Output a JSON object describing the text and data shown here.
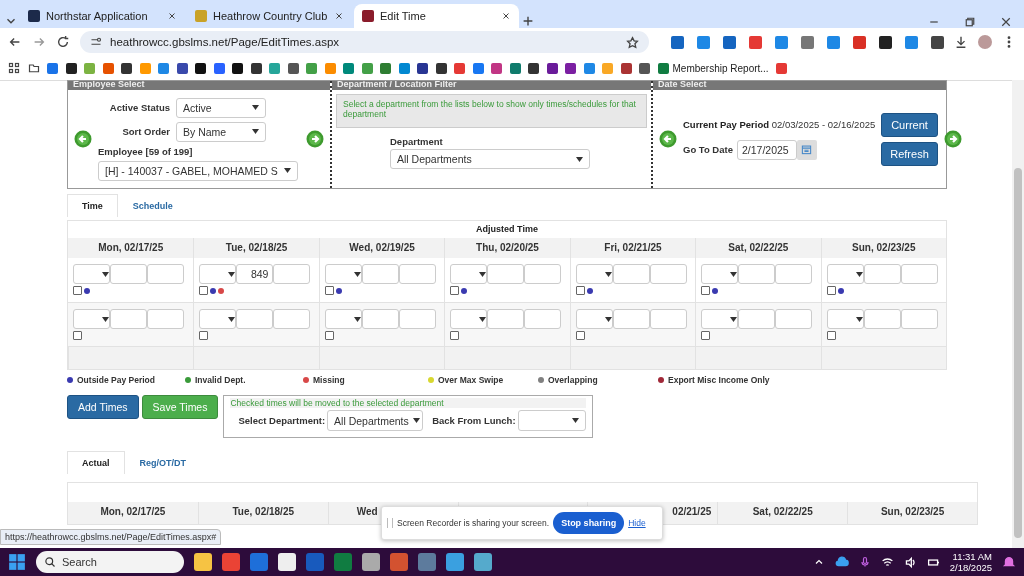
{
  "browser": {
    "tabs": [
      {
        "title": "Northstar Application",
        "selected": false
      },
      {
        "title": "Heathrow Country Club",
        "selected": false
      },
      {
        "title": "Edit Time",
        "selected": true
      }
    ],
    "url": "heathrowcc.gbslms.net/Page/EditTimes.aspx",
    "bookmark": "Membership Report..."
  },
  "employee_select": {
    "title": "Employee Select",
    "active_status_label": "Active Status",
    "active_status": "Active",
    "sort_order_label": "Sort Order",
    "sort_order": "By Name",
    "employee_label": "Employee [59 of 199]",
    "employee": "[H] - 140037 - GABEL, MOHAMED S"
  },
  "department_filter": {
    "title": "Department / Location Filter",
    "note": "Select a department from the lists below to show only times/schedules for that department",
    "label": "Department",
    "value": "All Departments"
  },
  "date_select": {
    "title": "Date Select",
    "pay_period_label": "Current Pay Period",
    "pay_period": "02/03/2025 - 02/16/2025",
    "go_to_label": "Go To Date",
    "go_to_value": "2/17/2025",
    "buttons": [
      "Current",
      "Refresh"
    ]
  },
  "time_tabs": [
    {
      "label": "Time",
      "selected": true
    },
    {
      "label": "Schedule",
      "selected": false
    }
  ],
  "adjusted_time": {
    "title": "Adjusted Time",
    "days": [
      {
        "label": "Mon, 02/17/25",
        "entries": [
          {
            "checked": false,
            "dots": [
              {
                "color": "#3a3ab0"
              }
            ]
          },
          {
            "checked": false
          }
        ]
      },
      {
        "label": "Tue, 02/18/25",
        "entries": [
          {
            "value": "849",
            "checked": false,
            "dots": [
              {
                "color": "#3a3ab0"
              },
              {
                "color": "#d84848"
              }
            ]
          },
          {
            "checked": false
          }
        ]
      },
      {
        "label": "Wed, 02/19/25",
        "entries": [
          {
            "checked": false,
            "dots": [
              {
                "color": "#3a3ab0"
              }
            ]
          },
          {
            "checked": false
          }
        ]
      },
      {
        "label": "Thu, 02/20/25",
        "entries": [
          {
            "checked": false,
            "dots": [
              {
                "color": "#3a3ab0"
              }
            ]
          },
          {
            "checked": false
          }
        ]
      },
      {
        "label": "Fri, 02/21/25",
        "entries": [
          {
            "checked": false,
            "dots": [
              {
                "color": "#3a3ab0"
              }
            ]
          },
          {
            "checked": false
          }
        ]
      },
      {
        "label": "Sat, 02/22/25",
        "entries": [
          {
            "checked": false,
            "dots": [
              {
                "color": "#3a3ab0"
              }
            ]
          },
          {
            "checked": false
          }
        ]
      },
      {
        "label": "Sun, 02/23/25",
        "entries": [
          {
            "checked": false,
            "dots": [
              {
                "color": "#3a3ab0"
              }
            ]
          },
          {
            "checked": false
          }
        ]
      }
    ]
  },
  "legend": [
    {
      "label": "Outside Pay Period",
      "color": "#3a3ab0"
    },
    {
      "label": "Invalid Dept.",
      "color": "#3a9a3a"
    },
    {
      "label": "Missing",
      "color": "#d84848"
    },
    {
      "label": "Over Max Swipe",
      "color": "#d8d830"
    },
    {
      "label": "Overlapping",
      "color": "#808080"
    },
    {
      "label": "Export Misc Income Only",
      "color": "#a02838"
    }
  ],
  "actions": {
    "buttons": [
      {
        "label": "Add Times",
        "kind": "primary"
      },
      {
        "label": "Save Times",
        "kind": "success"
      }
    ],
    "move_note": "Checked times will be moved to the selected department",
    "department_label": "Select Department:",
    "department_value": "All Departments",
    "lunch_label": "Back From Lunch:"
  },
  "result_tabs": [
    {
      "label": "Actual",
      "selected": true
    },
    {
      "label": "Reg/OT/DT",
      "selected": false
    }
  ],
  "actual_time": {
    "day_headers": [
      "Mon, 02/17/25",
      "Tue, 02/18/25",
      "Wed",
      "02/21/25",
      "Sat, 02/22/25",
      "Sun, 02/23/25"
    ]
  },
  "status_url": "https://heathrowcc.gbslms.net/Page/EditTimes.aspx#",
  "screen_share": {
    "message": "Screen Recorder is sharing your screen.",
    "stop": "Stop sharing",
    "hide": "Hide"
  },
  "taskbar": {
    "search": "Search",
    "time": "11:31 AM",
    "date": "2/18/2025"
  }
}
